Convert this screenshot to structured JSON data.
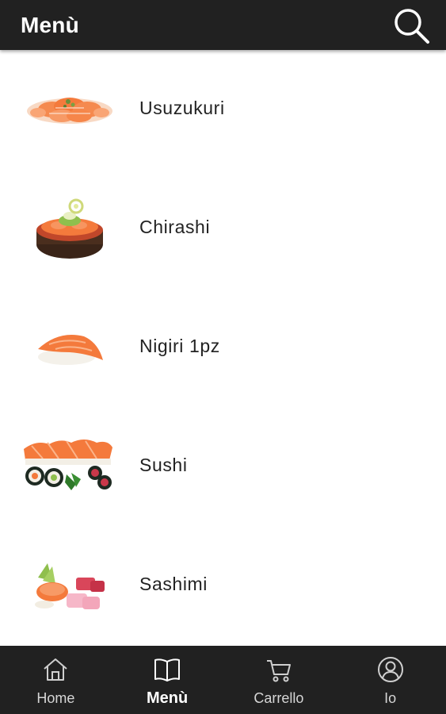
{
  "header": {
    "title": "Menù",
    "search_icon": "search-icon"
  },
  "menu_items": [
    {
      "label": "Usuzukuri",
      "image": "usuzukuri-image"
    },
    {
      "label": "Chirashi",
      "image": "chirashi-image"
    },
    {
      "label": "Nigiri 1pz",
      "image": "nigiri-image"
    },
    {
      "label": "Sushi",
      "image": "sushi-image"
    },
    {
      "label": "Sashimi",
      "image": "sashimi-image"
    }
  ],
  "bottom_nav": {
    "items": [
      {
        "label": "Home",
        "icon": "home-icon"
      },
      {
        "label": "Menù",
        "icon": "book-icon",
        "active": true
      },
      {
        "label": "Carrello",
        "icon": "cart-icon"
      },
      {
        "label": "Io",
        "icon": "user-icon"
      }
    ]
  },
  "colors": {
    "bar_background": "#212121",
    "text_dark": "#222222",
    "salmon": "#f47a3c"
  }
}
